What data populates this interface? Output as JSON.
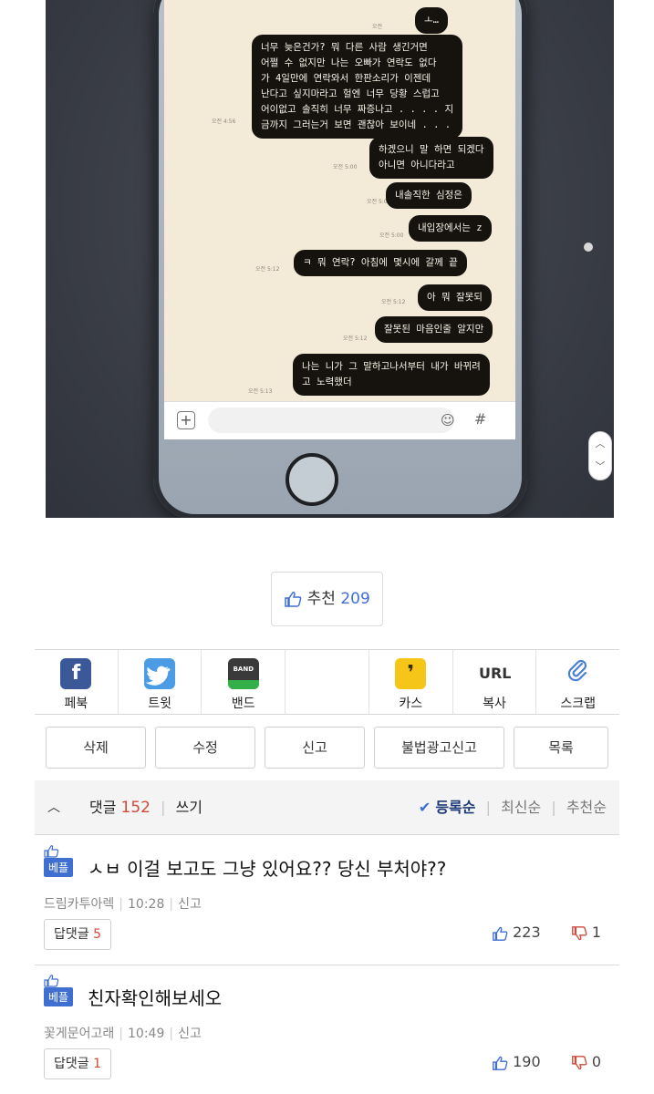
{
  "photo": {
    "messages": [
      {
        "text": "ㅗ…",
        "time": "오전"
      },
      {
        "text": "너무 늦은건가? 뭐 다른 사람 생긴거면\n어쩔 수 없지만 나는 오빠가 연락도 없다\n가 4일만에 연락와서 한판소리가 이젠데\n난다고 싶지마라고 헐엔 너무 당황 스럽고\n어이없고 솔직히 너무 짜증나고 . . . . 지\n금까지 그러는거 보면 괜찮아 보이네 . . .",
        "time": "오전 4:56"
      },
      {
        "text": "하겠으니 말 하면 되겠다\n아니면 아니다라고",
        "time": "오전 5:00"
      },
      {
        "text": "내솔직한 심정은",
        "time": "오전 5:00"
      },
      {
        "text": "내입장에서는 z",
        "time": "오전 5:00"
      },
      {
        "text": "ㅋ 뭐 연락? 아침에 몇시에 갈께 끝",
        "time": "오전 5:12"
      },
      {
        "text": "아 뭐 잘못되",
        "time": "오전 5:12"
      },
      {
        "text": "잘못된 마음인줄 알지만",
        "time": "오전 5:12"
      },
      {
        "text": "나는 니가 그 말하고나서부터 내가 바뀌려\n고 노력했더",
        "time": "오전 5:13"
      }
    ],
    "input_icons": {
      "plus": "+",
      "emoji": "☺",
      "hash": "#"
    }
  },
  "recommend": {
    "label": "추천",
    "count": "209"
  },
  "share": [
    {
      "key": "fb",
      "icon": "facebook-icon",
      "glyph": "f",
      "label": "페북"
    },
    {
      "key": "tw",
      "icon": "twitter-icon",
      "glyph": "",
      "label": "트윗"
    },
    {
      "key": "band",
      "icon": "band-icon",
      "glyph": "BAND",
      "label": "밴드"
    },
    {
      "key": "empty",
      "icon": "",
      "glyph": "",
      "label": ""
    },
    {
      "key": "kas",
      "icon": "kakaostory-icon",
      "glyph": "❜",
      "label": "카스"
    },
    {
      "key": "url",
      "icon": "url-icon",
      "glyph": "URL",
      "label": "복사"
    },
    {
      "key": "clip",
      "icon": "paperclip-icon",
      "glyph": "📎",
      "label": "스크랩"
    }
  ],
  "actions": [
    "삭제",
    "수정",
    "신고",
    "불법광고신고",
    "목록"
  ],
  "comments_header": {
    "label": "댓글",
    "count": "152",
    "write": "쓰기",
    "sort_active": "등록순",
    "sort_latest": "최신순",
    "sort_recommend": "추천순"
  },
  "comments": [
    {
      "badge": "베플",
      "text": "ㅅㅂ 이걸 보고도 그냥 있어요?? 당신 부처야??",
      "author": "드림카투아렉",
      "time": "10:28",
      "report": "신고",
      "reply_label": "답댓글",
      "reply_count": "5",
      "up": "223",
      "down": "1"
    },
    {
      "badge": "베플",
      "text": "친자확인해보세오",
      "author": "꽃게문어고래",
      "time": "10:49",
      "report": "신고",
      "reply_label": "답댓글",
      "reply_count": "1",
      "up": "190",
      "down": "0"
    }
  ],
  "colors": {
    "accent": "#3d6fd6",
    "count_red": "#d04a3a",
    "badge_blue": "#3f6fd0",
    "facebook": "#3b5998",
    "twitter": "#4b9ce4",
    "kakao": "#f5c518"
  }
}
